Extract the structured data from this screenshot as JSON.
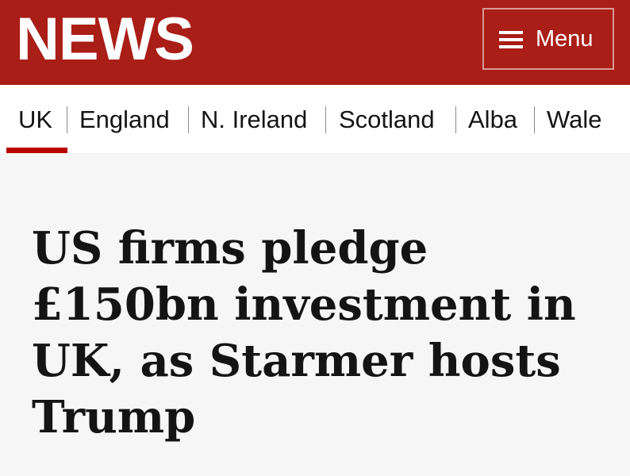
{
  "header": {
    "logo_text": "NEWS",
    "menu_label": "Menu",
    "menu_icon": "hamburger-icon",
    "background_color": "#a91e16"
  },
  "nav": {
    "items": [
      {
        "label": "UK",
        "active": true
      },
      {
        "label": "England"
      },
      {
        "label": "N. Ireland"
      },
      {
        "label": "Scotland"
      },
      {
        "label": "Alba"
      },
      {
        "label": "Wale"
      }
    ],
    "active_color": "#b80000"
  },
  "article": {
    "headline": "US firms pledge £150bn investment in UK, as Starmer hosts Trump"
  }
}
